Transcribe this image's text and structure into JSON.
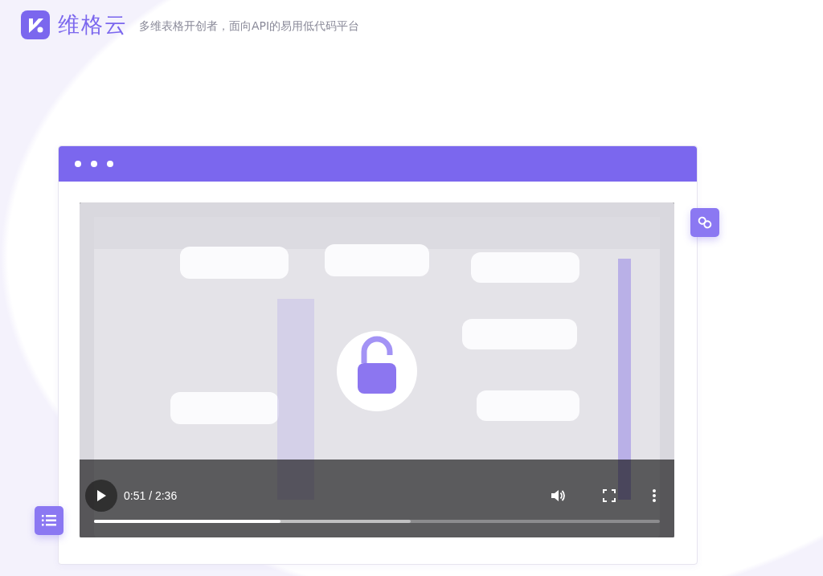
{
  "brand": {
    "name": "维格云",
    "tagline": "多维表格开创者，面向API的易用低代码平台"
  },
  "video": {
    "kind": "picture",
    "playing": false,
    "time": "0:51 / 2:36",
    "progress": {
      "level": 0.33
    },
    "buffered": {
      "level": 0.56
    }
  }
}
